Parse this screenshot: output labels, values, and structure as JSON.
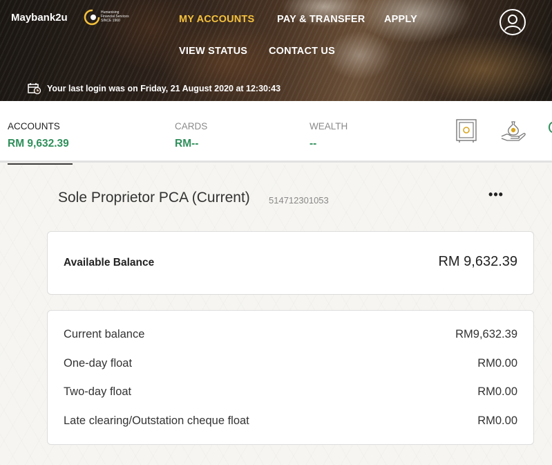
{
  "header": {
    "brand": "Maybank2u",
    "tagline": [
      "Humanising",
      "Financial Services",
      "SINCE 1960"
    ],
    "nav": {
      "my_accounts": "MY ACCOUNTS",
      "pay_transfer": "PAY & TRANSFER",
      "apply": "APPLY",
      "view_status": "VIEW STATUS",
      "contact_us": "CONTACT US"
    },
    "last_login": "Your last login was on Friday, 21 August 2020 at 12:30:43"
  },
  "summary": {
    "tabs": [
      {
        "label": "ACCOUNTS",
        "value": "RM 9,632.39"
      },
      {
        "label": "CARDS",
        "value": "RM--"
      },
      {
        "label": "WEALTH",
        "value": "--"
      }
    ],
    "icons": [
      "safe-deposit-icon",
      "money-bag-hand-icon"
    ]
  },
  "account": {
    "title": "Sole Proprietor PCA (Current)",
    "number": "514712301053",
    "more": "•••",
    "available_label": "Available Balance",
    "available_value": "RM 9,632.39",
    "balances": [
      {
        "label": "Current balance",
        "value": "RM9,632.39"
      },
      {
        "label": "One-day float",
        "value": "RM0.00"
      },
      {
        "label": "Two-day float",
        "value": "RM0.00"
      },
      {
        "label": "Late clearing/Outstation cheque float",
        "value": "RM0.00"
      }
    ]
  },
  "colors": {
    "accent_yellow": "#f4c13d",
    "accent_green": "#2f8f5b"
  }
}
